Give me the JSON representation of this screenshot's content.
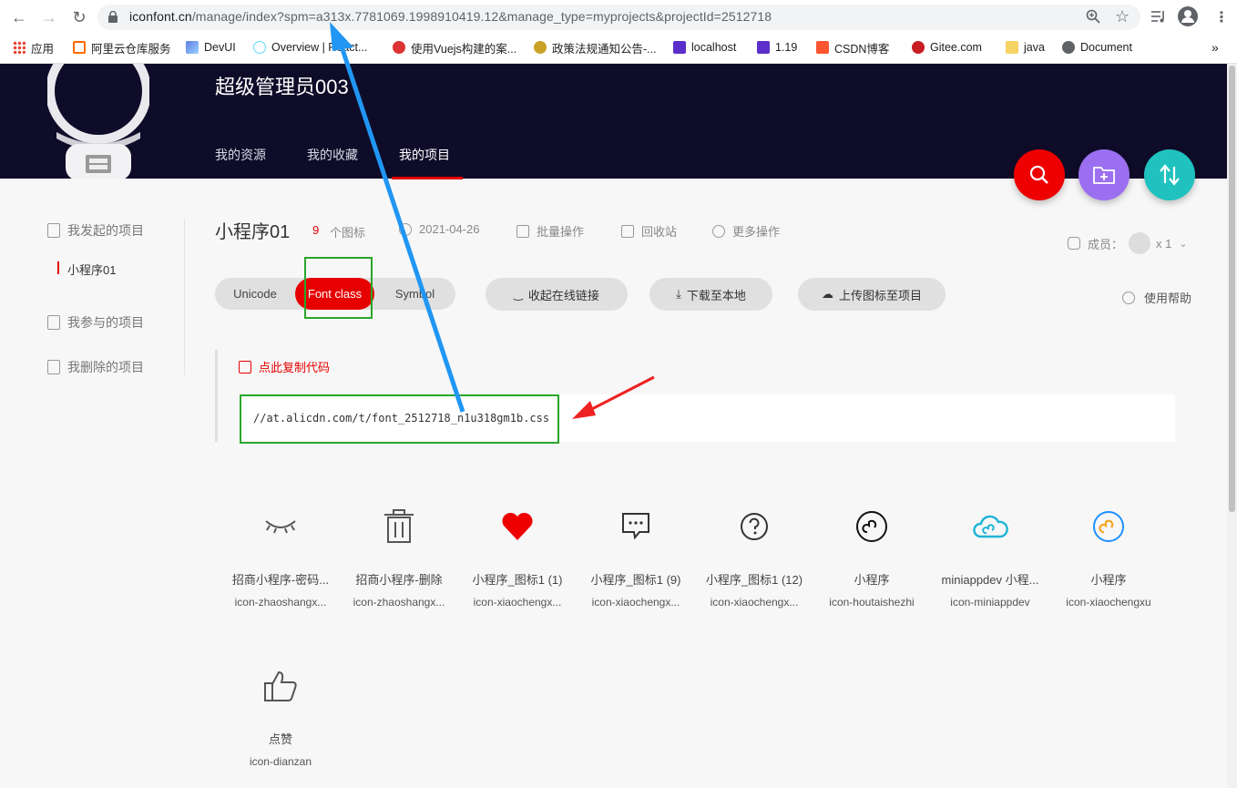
{
  "browser": {
    "url_host": "iconfont.cn",
    "url_rest": "/manage/index?spm=a313x.7781069.1998910419.12&manage_type=myprojects&projectId=2512718",
    "bookmarks": [
      "应用",
      "阿里云仓库服务",
      "DevUI",
      "Overview | React...",
      "使用Vuejs构建的案...",
      "政策法规通知公告-...",
      "localhost",
      "1.19",
      "CSDN博客",
      "Gitee.com",
      "java",
      "Document"
    ],
    "more": "»"
  },
  "header": {
    "username": "超级管理员003",
    "tabs": [
      "我的资源",
      "我的收藏",
      "我的项目"
    ],
    "active_tab": "我的项目"
  },
  "sidebar": {
    "initiated": "我发起的项目",
    "project": "小程序01",
    "participated": "我参与的项目",
    "deleted": "我删除的项目"
  },
  "project": {
    "title": "小程序01",
    "count": "9",
    "count_unit": "个图标",
    "date": "2021-04-26",
    "batch": "批量操作",
    "recycle": "回收站",
    "more": "更多操作",
    "members_label": "成员：",
    "members_count": "x 1"
  },
  "toolbar": {
    "modes": [
      "Unicode",
      "Font class",
      "Symbol"
    ],
    "active_mode": "Font class",
    "collapse_link": "收起在线链接",
    "download": "下载至本地",
    "upload": "上传图标至项目",
    "help": "使用帮助"
  },
  "code": {
    "copy_label": "点此复制代码",
    "url": "//at.alicdn.com/t/font_2512718_n1u318gm1b.css"
  },
  "icons": [
    {
      "name": "招商小程序-密码...",
      "class": "icon-zhaoshangx...",
      "glyph": "eye-closed-icon"
    },
    {
      "name": "招商小程序-删除",
      "class": "icon-zhaoshangx...",
      "glyph": "trash-icon"
    },
    {
      "name": "小程序_图标1 (1)",
      "class": "icon-xiaochengx...",
      "glyph": "heart-icon"
    },
    {
      "name": "小程序_图标1 (9)",
      "class": "icon-xiaochengx...",
      "glyph": "chat-icon"
    },
    {
      "name": "小程序_图标1 (12)",
      "class": "icon-xiaochengx...",
      "glyph": "question-icon"
    },
    {
      "name": "小程序",
      "class": "icon-houtaishezhi",
      "glyph": "miniapp-icon"
    },
    {
      "name": "miniappdev 小程...",
      "class": "icon-miniappdev",
      "glyph": "cloud-icon"
    },
    {
      "name": "小程序",
      "class": "icon-xiaochengxu",
      "glyph": "miniapp-color-icon"
    },
    {
      "name": "点赞",
      "class": "icon-dianzan",
      "glyph": "thumb-up-icon"
    }
  ],
  "colors": {
    "header_bg": "#0f0c29",
    "accent": "#e60000",
    "search_fab": "#ee0000",
    "add_fab": "#9b6ff0",
    "sort_fab": "#1fc2bf",
    "annotation_green": "#2aa52a",
    "annotation_blue": "#2196f3"
  }
}
